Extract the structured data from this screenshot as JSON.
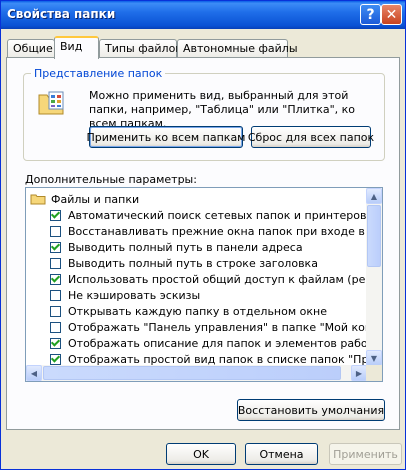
{
  "window": {
    "title": "Свойства папки"
  },
  "tabs": [
    {
      "label": "Общие"
    },
    {
      "label": "Вид"
    },
    {
      "label": "Типы файлов"
    },
    {
      "label": "Автономные файлы"
    }
  ],
  "folder_view": {
    "group_label": "Представление папок",
    "description": "Можно применить вид, выбранный для этой папки, например, \"Таблица\" или \"Плитка\", ко всем папкам.",
    "apply_all_label": "Применить ко всем папкам",
    "reset_all_label": "Сброс для всех папок"
  },
  "advanced": {
    "label": "Дополнительные параметры:",
    "root": "Файлы и папки",
    "items": [
      {
        "label": "Автоматический поиск сетевых папок и принтеров",
        "checked": true
      },
      {
        "label": "Восстанавливать прежние окна папок при входе в систем",
        "checked": false
      },
      {
        "label": "Выводить полный путь в панели адреса",
        "checked": true
      },
      {
        "label": "Выводить полный путь в строке заголовка",
        "checked": false
      },
      {
        "label": "Использовать простой общий доступ к файлам (рекоменд",
        "checked": true
      },
      {
        "label": "Не кэшировать эскизы",
        "checked": false
      },
      {
        "label": "Открывать каждую папку в отдельном окне",
        "checked": false
      },
      {
        "label": "Отображать \"Панель управления\" в папке \"Мой компьют",
        "checked": false
      },
      {
        "label": "Отображать описание для папок и элементов рабочего ст",
        "checked": true
      },
      {
        "label": "Отображать простой вид папок в списке папок \"Проводни",
        "checked": true
      }
    ]
  },
  "buttons": {
    "restore_defaults": "Восстановить умолчания",
    "ok": "OK",
    "cancel": "Отмена",
    "apply": "Применить"
  }
}
